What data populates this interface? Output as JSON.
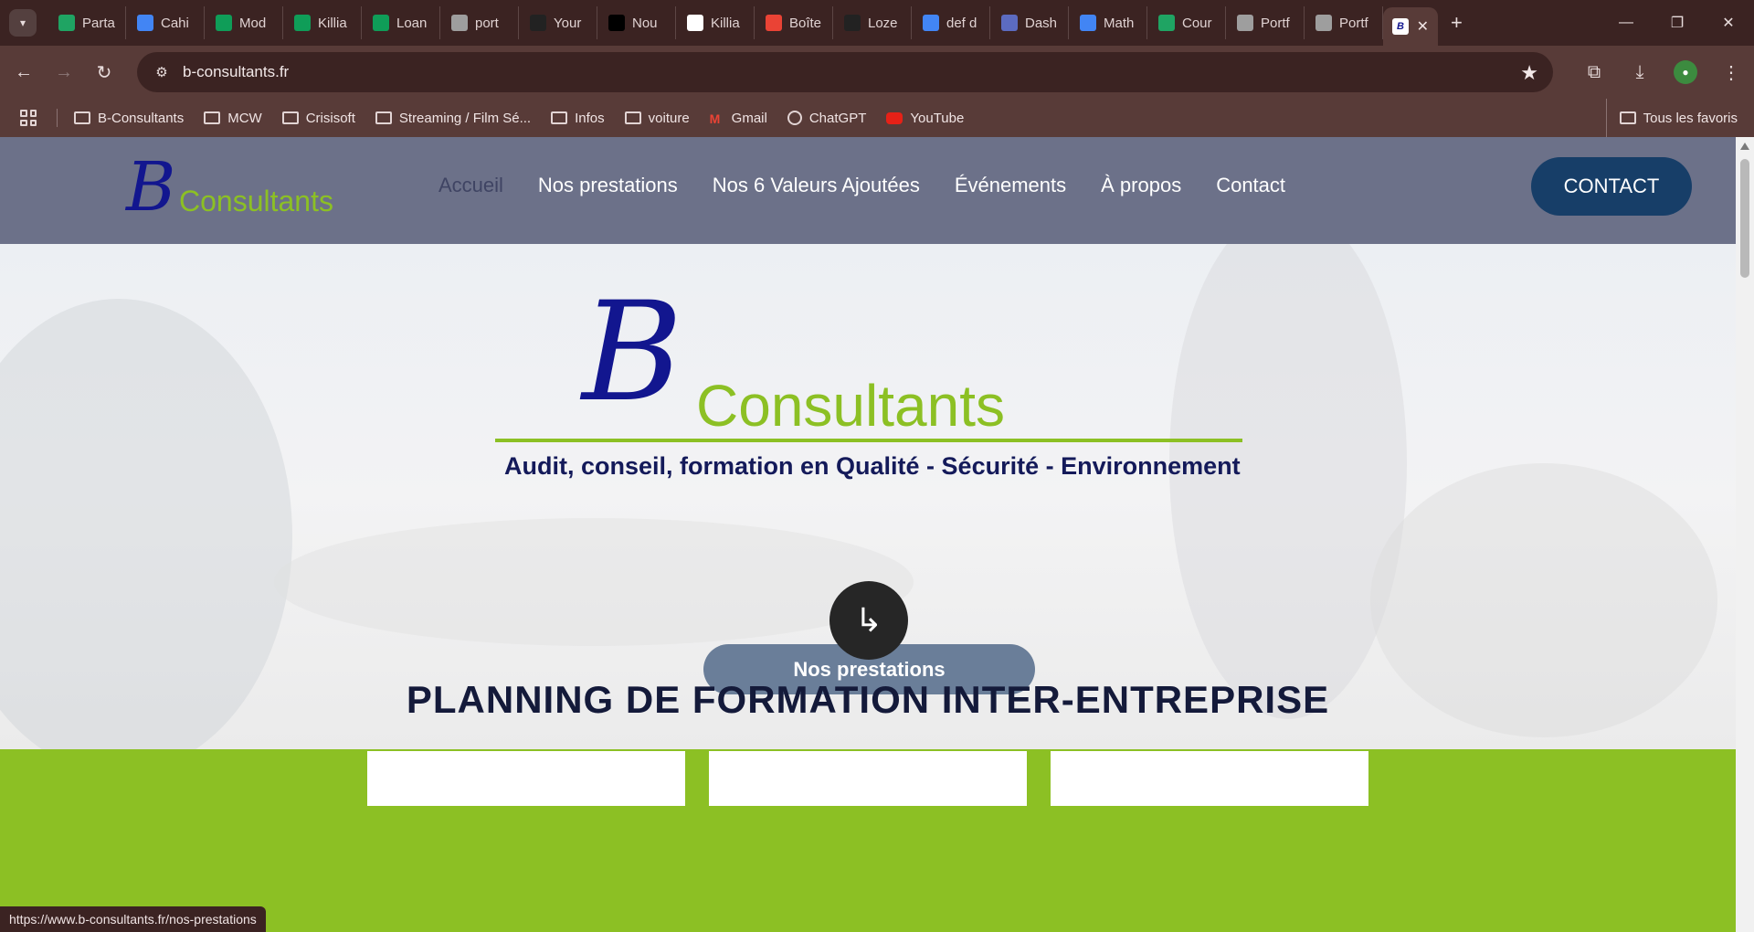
{
  "browser": {
    "tabs": [
      {
        "label": "Parta",
        "icon": "google-drive-icon",
        "color": "#1fa463"
      },
      {
        "label": "Cahi",
        "icon": "google-docs-icon",
        "color": "#4285f4"
      },
      {
        "label": "Mod",
        "icon": "google-sheets-icon",
        "color": "#0f9d58"
      },
      {
        "label": "Killia",
        "icon": "google-sheets-icon",
        "color": "#0f9d58"
      },
      {
        "label": "Loan",
        "icon": "google-sheets-icon",
        "color": "#0f9d58"
      },
      {
        "label": "port",
        "icon": "globe-icon",
        "color": "#9e9e9e"
      },
      {
        "label": "Your",
        "icon": "github-icon",
        "color": "#222222"
      },
      {
        "label": "Nou",
        "icon": "vercel-icon",
        "color": "#000000"
      },
      {
        "label": "Killia",
        "icon": "notion-icon",
        "color": "#ffffff"
      },
      {
        "label": "Boîte",
        "icon": "gmail-icon",
        "color": "#ea4335"
      },
      {
        "label": "Loze",
        "icon": "github-icon",
        "color": "#222222"
      },
      {
        "label": "def d",
        "icon": "google-icon",
        "color": "#4285f4"
      },
      {
        "label": "Dash",
        "icon": "dashboard-icon",
        "color": "#5c6bc0"
      },
      {
        "label": "Math",
        "icon": "google-docs-icon",
        "color": "#4285f4"
      },
      {
        "label": "Cour",
        "icon": "google-drive-icon",
        "color": "#1fa463"
      },
      {
        "label": "Portf",
        "icon": "globe-icon",
        "color": "#9e9e9e"
      },
      {
        "label": "Portf",
        "icon": "globe-icon",
        "color": "#9e9e9e"
      }
    ],
    "active_tab_icon": "b-consultants-icon",
    "address": "b-consultants.fr",
    "bookmarks": [
      {
        "label": "B-Consultants",
        "icon": "folder-icon"
      },
      {
        "label": "MCW",
        "icon": "folder-icon"
      },
      {
        "label": "Crisisoft",
        "icon": "folder-icon"
      },
      {
        "label": "Streaming / Film Sé...",
        "icon": "folder-icon"
      },
      {
        "label": "Infos",
        "icon": "folder-icon"
      },
      {
        "label": "voiture",
        "icon": "folder-icon"
      },
      {
        "label": "Gmail",
        "icon": "gmail-icon"
      },
      {
        "label": "ChatGPT",
        "icon": "chatgpt-icon"
      },
      {
        "label": "YouTube",
        "icon": "youtube-icon"
      }
    ],
    "all_bookmarks": "Tous les favoris",
    "status_url": "https://www.b-consultants.fr/nos-prestations"
  },
  "site": {
    "logo_b": "B",
    "logo_text": "Consultants",
    "nav": [
      "Accueil",
      "Nos prestations",
      "Nos 6 Valeurs Ajoutées",
      "Événements",
      "À propos",
      "Contact"
    ],
    "contact_button": "CONTACT",
    "hero": {
      "logo_b": "B",
      "logo_text": "Consultants",
      "tagline": "Audit, conseil, formation en Qualité - Sécurité - Environnement",
      "button": "Nos prestations"
    },
    "planning_title": "PLANNING DE FORMATION INTER-ENTREPRISE",
    "colors": {
      "header": "#6c7189",
      "brand_blue": "#12168f",
      "brand_green": "#8cc024",
      "contact": "#173e68"
    }
  }
}
